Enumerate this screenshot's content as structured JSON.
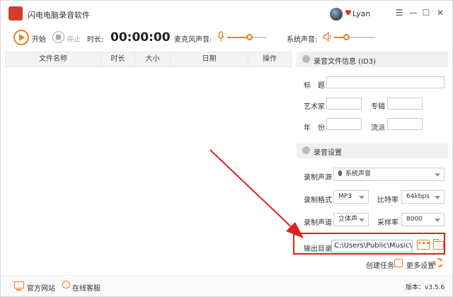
{
  "app": {
    "title": "闪电电脑录音软件",
    "user": "Lyan"
  },
  "window_controls": [
    "☰",
    "—",
    "☐",
    "✕"
  ],
  "toolbar": {
    "start_label": "开始",
    "stop_label": "停止",
    "duration_label": "时长:",
    "timer": "00:00:00",
    "mic_volume_label": "麦克风声音:",
    "mic_volume_level": 0.55,
    "system_volume_label": "系统声音:",
    "system_volume_level": 0.3
  },
  "table": {
    "columns": [
      "文件名称",
      "时长",
      "大小",
      "日期",
      "操作"
    ],
    "rows": []
  },
  "id3_section": {
    "title": "录音文件信息 (ID3)",
    "title_label": "标　题",
    "artist_label": "艺术家",
    "album_label": "专辑",
    "year_label": "年　份",
    "genre_label": "流派"
  },
  "settings_section": {
    "title": "录音设置",
    "source_label": "录制声源",
    "source_value": "系统声音",
    "format_label": "录制格式",
    "format_value": "MP3",
    "bitrate_label": "比特率",
    "bitrate_value": "64kbps",
    "channel_label": "录制声道",
    "channel_value": "立体声",
    "samplerate_label": "采样率",
    "samplerate_value": "8000",
    "output_label": "输出目录",
    "output_value": "C:\\Users\\Public\\Music\\闪电",
    "dots_label": "•••"
  },
  "actions": {
    "create_task": "创建任务",
    "more_settings": "更多设置"
  },
  "statusbar": {
    "website": "官方网站",
    "support": "在线客服",
    "version": "版本：v3.5.6"
  },
  "colors": {
    "accent": "#f07d1e",
    "highlight": "#e02020",
    "logo": "#d63b2f"
  }
}
